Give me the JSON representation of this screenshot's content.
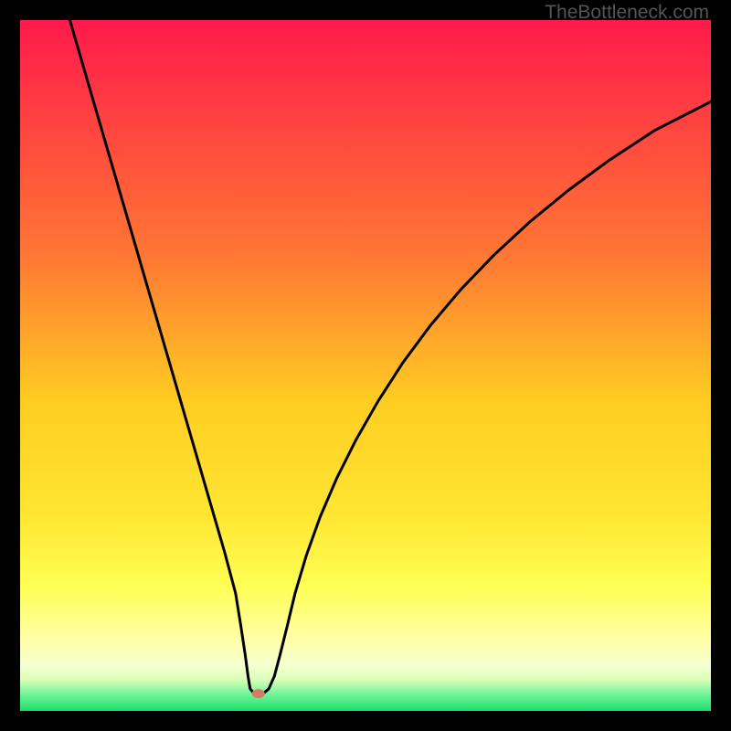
{
  "attribution": "TheBottleneck.com",
  "chart_data": {
    "type": "line",
    "title": "",
    "xlabel": "",
    "ylabel": "",
    "xlim": [
      0,
      1
    ],
    "ylim": [
      0,
      1
    ],
    "gradient_stops": [
      {
        "offset": 0.0,
        "color": "#ff1a4b"
      },
      {
        "offset": 0.35,
        "color": "#ff7a33"
      },
      {
        "offset": 0.55,
        "color": "#ffcc22"
      },
      {
        "offset": 0.72,
        "color": "#ffe733"
      },
      {
        "offset": 0.82,
        "color": "#ffff55"
      },
      {
        "offset": 0.89,
        "color": "#ffffa0"
      },
      {
        "offset": 0.935,
        "color": "#f6ffd0"
      },
      {
        "offset": 0.955,
        "color": "#d8ffb8"
      },
      {
        "offset": 0.975,
        "color": "#76f59a"
      },
      {
        "offset": 1.0,
        "color": "#18e06a"
      }
    ],
    "optimum_point": {
      "x": 0.345,
      "y": 0.975
    },
    "series": [
      {
        "name": "bottleneck-curve",
        "points": [
          {
            "x": 0.072,
            "y": 0.0
          },
          {
            "x": 0.088,
            "y": 0.055
          },
          {
            "x": 0.104,
            "y": 0.11
          },
          {
            "x": 0.12,
            "y": 0.165
          },
          {
            "x": 0.136,
            "y": 0.22
          },
          {
            "x": 0.152,
            "y": 0.275
          },
          {
            "x": 0.168,
            "y": 0.33
          },
          {
            "x": 0.184,
            "y": 0.385
          },
          {
            "x": 0.2,
            "y": 0.44
          },
          {
            "x": 0.216,
            "y": 0.495
          },
          {
            "x": 0.232,
            "y": 0.55
          },
          {
            "x": 0.248,
            "y": 0.605
          },
          {
            "x": 0.264,
            "y": 0.66
          },
          {
            "x": 0.28,
            "y": 0.715
          },
          {
            "x": 0.296,
            "y": 0.77
          },
          {
            "x": 0.312,
            "y": 0.83
          },
          {
            "x": 0.32,
            "y": 0.88
          },
          {
            "x": 0.326,
            "y": 0.92
          },
          {
            "x": 0.33,
            "y": 0.95
          },
          {
            "x": 0.333,
            "y": 0.968
          },
          {
            "x": 0.338,
            "y": 0.974
          },
          {
            "x": 0.345,
            "y": 0.975
          },
          {
            "x": 0.352,
            "y": 0.975
          },
          {
            "x": 0.36,
            "y": 0.968
          },
          {
            "x": 0.368,
            "y": 0.95
          },
          {
            "x": 0.376,
            "y": 0.92
          },
          {
            "x": 0.386,
            "y": 0.88
          },
          {
            "x": 0.398,
            "y": 0.83
          },
          {
            "x": 0.414,
            "y": 0.776
          },
          {
            "x": 0.434,
            "y": 0.72
          },
          {
            "x": 0.458,
            "y": 0.664
          },
          {
            "x": 0.486,
            "y": 0.608
          },
          {
            "x": 0.518,
            "y": 0.552
          },
          {
            "x": 0.554,
            "y": 0.496
          },
          {
            "x": 0.594,
            "y": 0.442
          },
          {
            "x": 0.638,
            "y": 0.39
          },
          {
            "x": 0.686,
            "y": 0.34
          },
          {
            "x": 0.738,
            "y": 0.292
          },
          {
            "x": 0.794,
            "y": 0.246
          },
          {
            "x": 0.854,
            "y": 0.202
          },
          {
            "x": 0.918,
            "y": 0.16
          },
          {
            "x": 1.0,
            "y": 0.118
          }
        ]
      }
    ]
  }
}
